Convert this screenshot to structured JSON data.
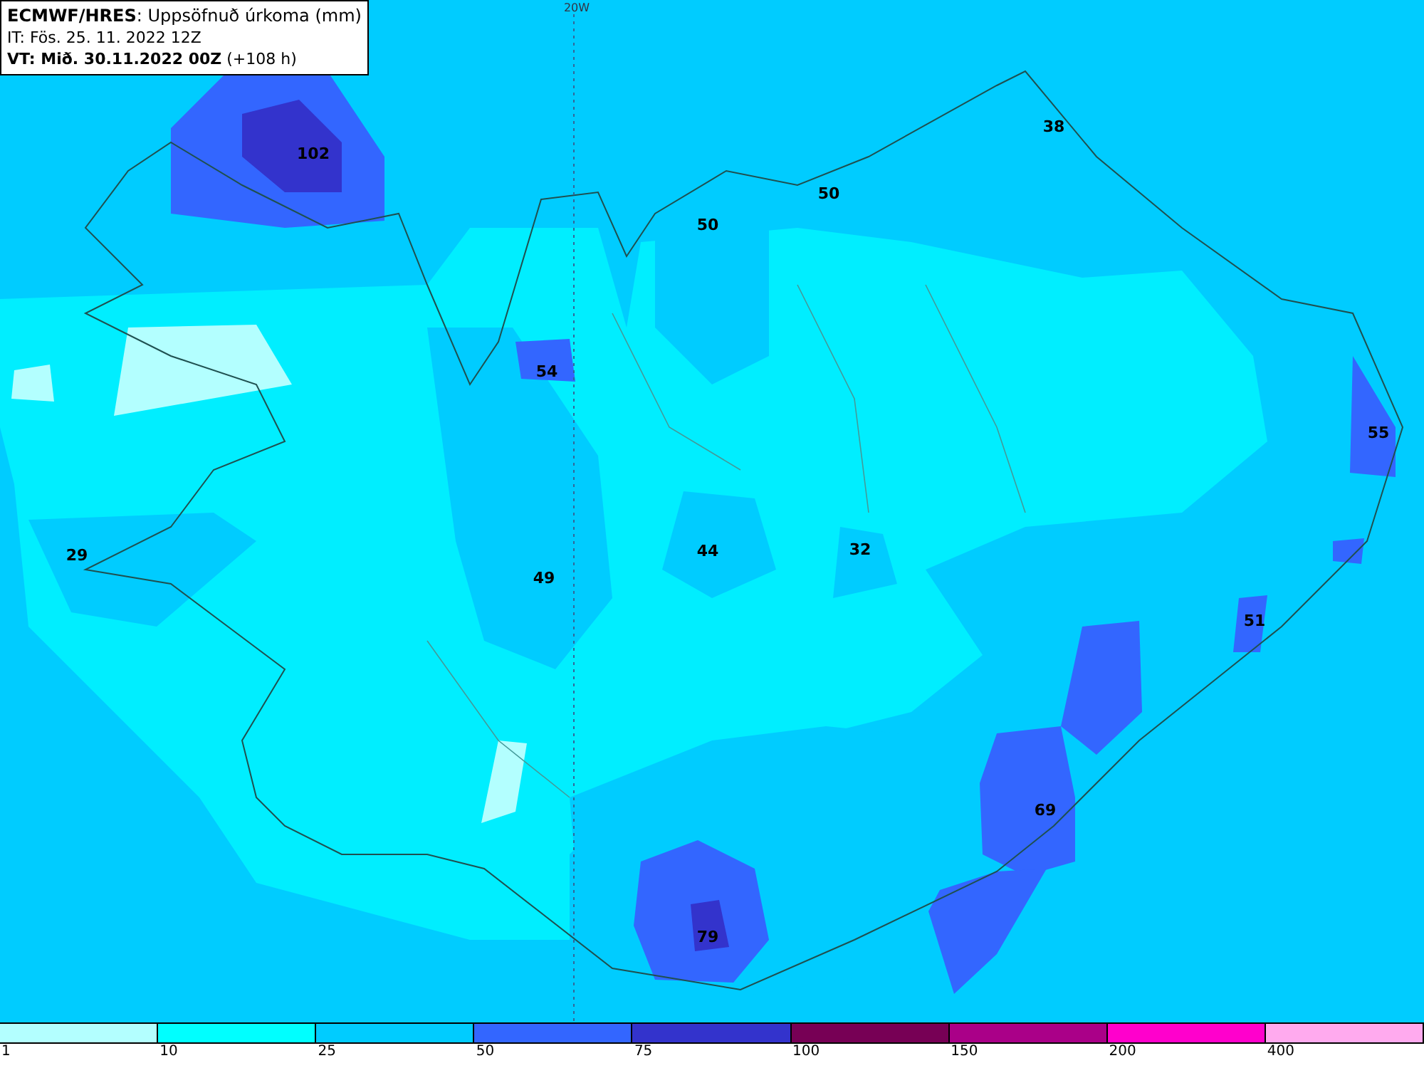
{
  "header": {
    "title": "**ECMWF/HRES**: Uppsöfnuð úrkoma (mm)",
    "init_time": "IT: Fös. 25. 11. 2022 12Z",
    "valid_time": "**VT: Mið. 30.11.2022 00Z** (+108 h)"
  },
  "meridian_label": "20W",
  "values": [
    "102",
    "38",
    "50",
    "50",
    "54",
    "55",
    "29",
    "44",
    "32",
    "49",
    "51",
    "69",
    "79"
  ],
  "legend": [
    {
      "label": "1",
      "color": "#b3ffff"
    },
    {
      "label": "10",
      "color": "#00ffff"
    },
    {
      "label": "25",
      "color": "#00ccff"
    },
    {
      "label": "50",
      "color": "#3366ff"
    },
    {
      "label": "75",
      "color": "#3333cc"
    },
    {
      "label": "100",
      "color": "#770055"
    },
    {
      "label": "150",
      "color": "#aa0088"
    },
    {
      "label": "200",
      "color": "#ff00cc"
    },
    {
      "label": "400",
      "color": "#ffaaee"
    }
  ]
}
